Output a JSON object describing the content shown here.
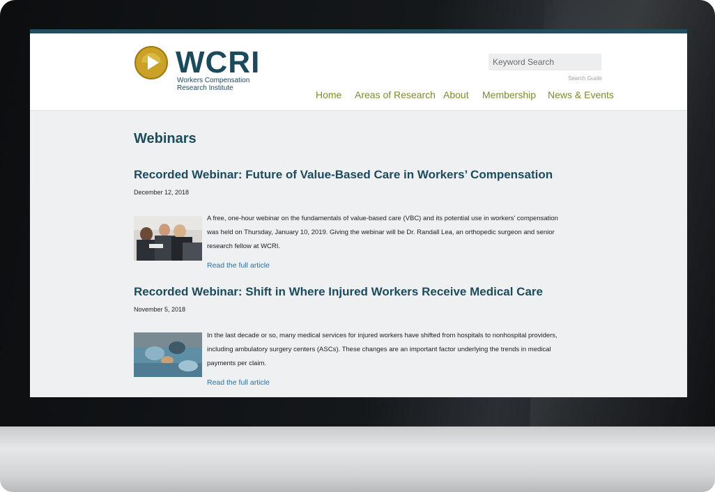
{
  "header": {
    "logo_text": "WCRI",
    "logo_subtitle": "Workers Compensation Research Institute",
    "search_placeholder": "Keyword Search",
    "search_guide": "Search Guide"
  },
  "nav": {
    "items": [
      "Home",
      "Areas of Research",
      "About",
      "Membership",
      "News & Events"
    ]
  },
  "page": {
    "title": "Webinars"
  },
  "articles": [
    {
      "title": "Recorded Webinar: Future of Value-Based Care in Workers’ Compensation",
      "date": "December 12, 2018",
      "body": "A free, one-hour webinar on the fundamentals of value-based care (VBC) and its potential use in workers’ compensation was held on Thursday, January 10, 2019. Giving the webinar will be Dr. Randall Lea, an orthopedic surgeon and senior research fellow at WCRI.",
      "link": "Read the full article"
    },
    {
      "title": "Recorded Webinar: Shift in Where Injured Workers Receive Medical Care",
      "date": "November 5, 2018",
      "body": "In the last decade or so, many medical services for injured workers have shifted from hospitals to nonhospital providers, including ambulatory surgery centers (ASCs). These changes are an important factor underlying the trends in medical payments per claim.",
      "link": "Read the full article"
    }
  ],
  "colors": {
    "brand_teal": "#1c4b5d",
    "nav_olive": "#7d8a2d",
    "link_blue": "#2a6fa8",
    "logo_gold": "#c9a227"
  }
}
